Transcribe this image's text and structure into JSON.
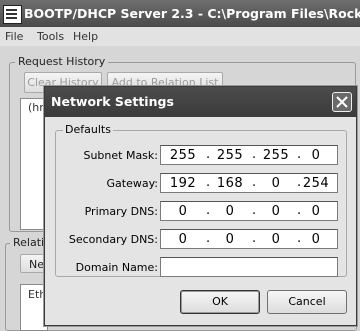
{
  "main_window": {
    "title": "BOOTP/DHCP Server 2.3 - C:\\Program Files\\Rockwell So",
    "menu": [
      "File",
      "Tools",
      "Help"
    ],
    "request_history": {
      "legend": "Request History",
      "clear_history_label": "Clear History",
      "add_to_relation_label": "Add to Relation List",
      "list_header_fragment": "(hr:"
    },
    "relation_list": {
      "legend_fragment": "Relati",
      "new_button_fragment": "Ne",
      "column_fragment": "Eth"
    }
  },
  "dialog": {
    "title": "Network Settings",
    "group_label": "Defaults",
    "fields": [
      {
        "label": "Subnet Mask:",
        "octets": [
          "255",
          "255",
          "255",
          "0"
        ]
      },
      {
        "label": "Gateway:",
        "octets": [
          "192",
          "168",
          "0",
          "254"
        ]
      },
      {
        "label": "Primary DNS:",
        "octets": [
          "0",
          "0",
          "0",
          "0"
        ]
      },
      {
        "label": "Secondary DNS:",
        "octets": [
          "0",
          "0",
          "0",
          "0"
        ]
      }
    ],
    "domain_name": {
      "label": "Domain Name:",
      "value": ""
    },
    "ok_label": "OK",
    "cancel_label": "Cancel"
  }
}
